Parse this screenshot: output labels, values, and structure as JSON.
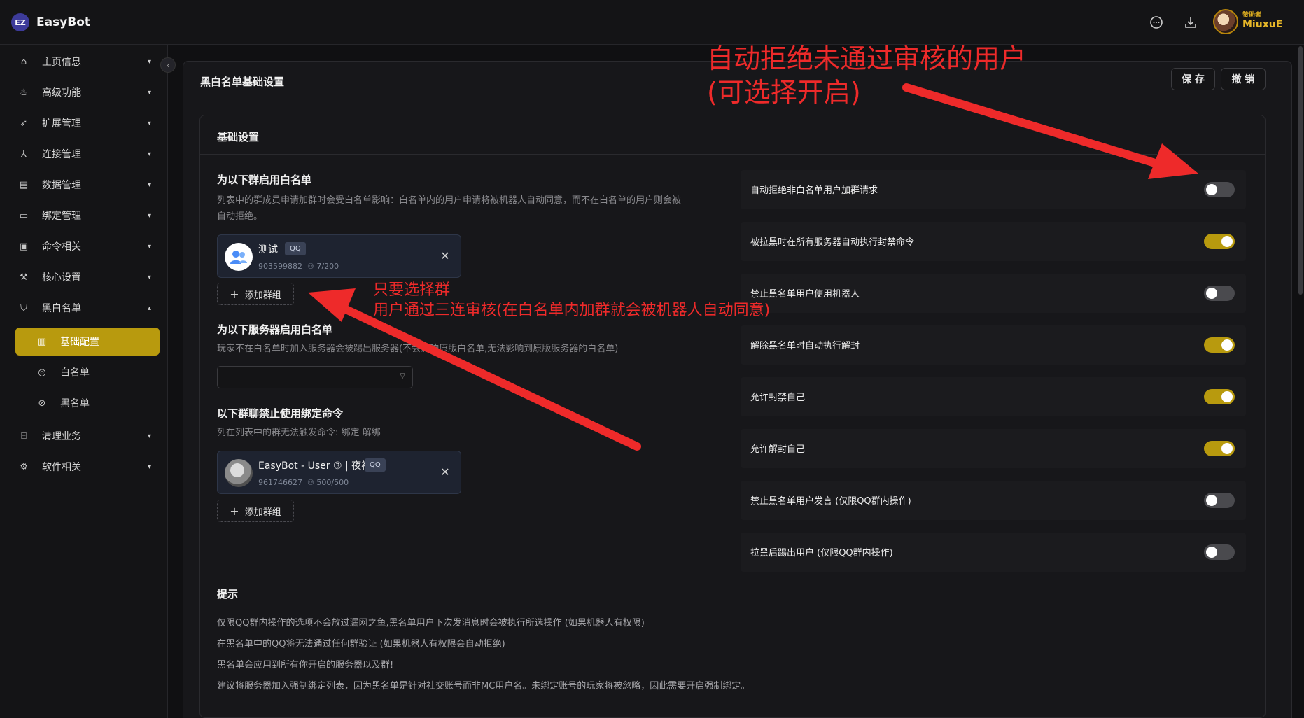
{
  "app": {
    "logo_text": "EZ",
    "name": "EasyBot"
  },
  "topbar": {
    "icons": [
      "chat-icon",
      "download-icon"
    ],
    "user": {
      "role": "赞助者",
      "name": "MiuxuE"
    }
  },
  "sidebar": {
    "items": [
      {
        "label": "主页信息",
        "icon": "home-icon",
        "chevron": "down"
      },
      {
        "label": "高级功能",
        "icon": "flame-icon",
        "chevron": "down"
      },
      {
        "label": "扩展管理",
        "icon": "rocket-icon",
        "chevron": "down"
      },
      {
        "label": "连接管理",
        "icon": "network-icon",
        "chevron": "down"
      },
      {
        "label": "数据管理",
        "icon": "database-icon",
        "chevron": "down"
      },
      {
        "label": "绑定管理",
        "icon": "id-card-icon",
        "chevron": "down"
      },
      {
        "label": "命令相关",
        "icon": "terminal-icon",
        "chevron": "down"
      },
      {
        "label": "核心设置",
        "icon": "wrench-icon",
        "chevron": "down"
      },
      {
        "label": "黑白名单",
        "icon": "shield-icon",
        "chevron": "up"
      }
    ],
    "sub_items": [
      {
        "label": "基础配置",
        "icon": "chart-icon",
        "active": true
      },
      {
        "label": "白名单",
        "icon": "check-circle-icon",
        "active": false
      },
      {
        "label": "黑名单",
        "icon": "ban-icon",
        "active": false
      }
    ],
    "bottom_items": [
      {
        "label": "清理业务",
        "icon": "broom-icon",
        "chevron": "down"
      },
      {
        "label": "软件相关",
        "icon": "gear-icon",
        "chevron": "down"
      }
    ]
  },
  "main": {
    "title": "黑白名单基础设置",
    "save_label": "保 存",
    "cancel_label": "撤 销",
    "section_title": "基础设置",
    "whitelist_groups": {
      "title": "为以下群启用白名单",
      "desc_line1": "列表中的群成员申请加群时会受白名单影响：白名单内的用户申请将被机器人自动同意，而不在白名单的用户则会被",
      "desc_line2": "自动拒绝。",
      "groups": [
        {
          "name": "测试",
          "tag": "QQ",
          "id": "903599882",
          "count": "7/200"
        }
      ],
      "add_label": "添加群组"
    },
    "whitelist_servers": {
      "title": "为以下服务器启用白名单",
      "desc": "玩家不在白名单时加入服务器会被踢出服务器(不会影响原版白名单,无法影响到原版服务器的白名单)",
      "selected": ""
    },
    "bind_block": {
      "title": "以下群聊禁止使用绑定命令",
      "desc": "列在列表中的群无法触发命令: 绑定 解绑",
      "groups": [
        {
          "name": "EasyBot - User ③ | 夜视",
          "tag": "QQ",
          "id": "961746627",
          "count": "500/500"
        }
      ],
      "add_label": "添加群组"
    },
    "settings": [
      {
        "label": "自动拒绝非白名单用户加群请求",
        "on": false
      },
      {
        "label": "被拉黑时在所有服务器自动执行封禁命令",
        "on": true
      },
      {
        "label": "禁止黑名单用户使用机器人",
        "on": false
      },
      {
        "label": "解除黑名单时自动执行解封",
        "on": true
      },
      {
        "label": "允许封禁自己",
        "on": true
      },
      {
        "label": "允许解封自己",
        "on": true
      },
      {
        "label": "禁止黑名单用户发言 (仅限QQ群内操作)",
        "on": false
      },
      {
        "label": "拉黑后踢出用户 (仅限QQ群内操作)",
        "on": false
      }
    ],
    "tips": {
      "title": "提示",
      "lines": [
        "仅限QQ群内操作的选项不会放过漏网之鱼,黑名单用户下次发消息时会被执行所选操作 (如果机器人有权限)",
        "在黑名单中的QQ将无法通过任何群验证 (如果机器人有权限会自动拒绝)",
        "黑名单会应用到所有你开启的服务器以及群!",
        "建议将服务器加入强制绑定列表，因为黑名单是针对社交账号而非MC用户名。未绑定账号的玩家将被忽略，因此需要开启强制绑定。"
      ]
    }
  },
  "annotations": {
    "big_line1": "自动拒绝未通过审核的用户",
    "big_line2": "(可选择开启)",
    "small_line1": "只要选择群",
    "small_line2": "用户通过三连审核(在白名单内加群就会被机器人自动同意)",
    "color": "#ee2a2a"
  },
  "colors": {
    "accent": "#b89a0e",
    "background": "#101012"
  }
}
